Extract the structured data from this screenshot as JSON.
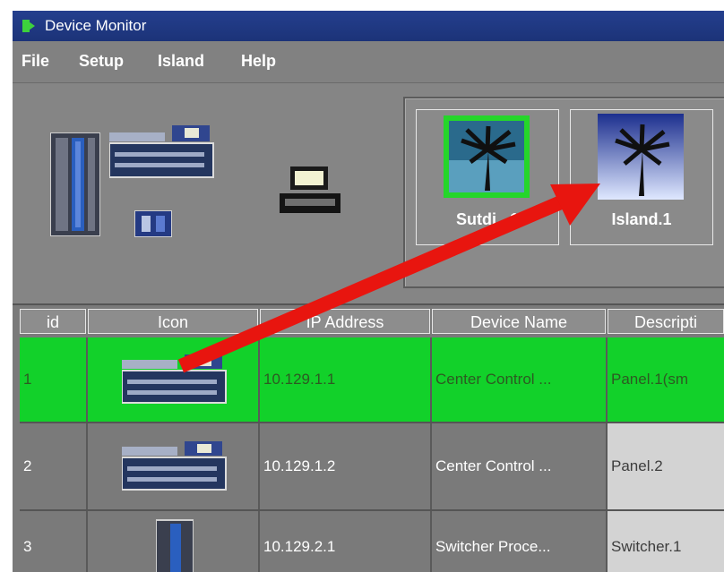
{
  "window": {
    "title": "Device Monitor",
    "title_icon": "app-icon"
  },
  "menu": [
    "File",
    "Setup",
    "Island",
    "Help"
  ],
  "islands": [
    {
      "label": "Sutdi...1",
      "icon": "palm-tree-icon",
      "active": true
    },
    {
      "label": "Island.1",
      "icon": "palm-tree-icon",
      "active": false
    }
  ],
  "table": {
    "columns": [
      "id",
      "Icon",
      "IP Address",
      "Device Name",
      "Descripti"
    ],
    "rows": [
      {
        "id": "1",
        "icon": "panel-device-icon",
        "ip": "10.129.1.1",
        "name": "Center Control ...",
        "desc": "Panel.1(sm",
        "selected": true
      },
      {
        "id": "2",
        "icon": "panel-device-icon",
        "ip": "10.129.1.2",
        "name": "Center Control ...",
        "desc": "Panel.2",
        "selected": false
      },
      {
        "id": "3",
        "icon": "switcher-device-icon",
        "ip": "10.129.2.1",
        "name": "Switcher Proce...",
        "desc": "Switcher.1",
        "selected": false
      }
    ]
  },
  "annotation": {
    "arrow_color": "#e8150f"
  },
  "colors": {
    "selected_row": "#12d12a",
    "titlebar": "#243f8e"
  }
}
